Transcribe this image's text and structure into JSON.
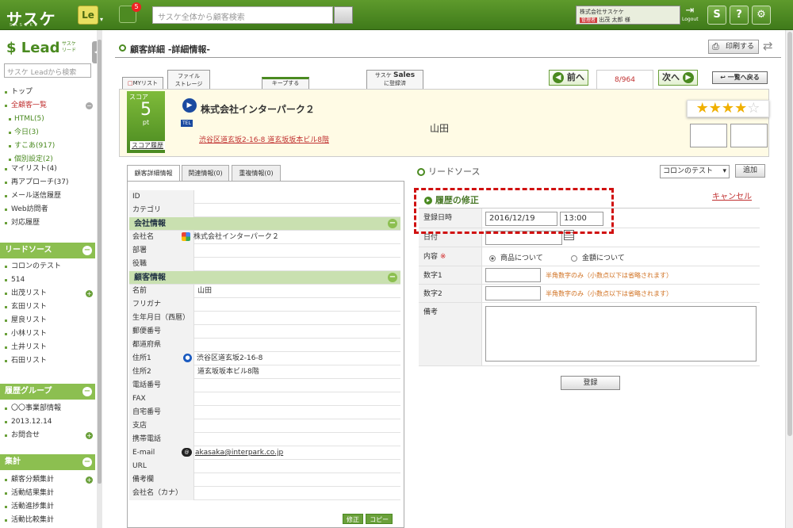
{
  "app": {
    "logo": "サスケ",
    "logo_sub": "SASUKE",
    "le": "Le",
    "notif_count": "5",
    "search_placeholder": "サスケ全体から顧客検索",
    "company": "株式会社サスケケ",
    "admin_tag": "管理者",
    "user": "出茂 太郎 様",
    "logout": "Logout"
  },
  "sidebar": {
    "logo": "Lead",
    "logo_sub1": "サスケ",
    "logo_sub2": "リード",
    "search_placeholder": "サスケ Leadから検索",
    "nav1": [
      "トップ",
      "全顧客一覧",
      "HTML(5)",
      "今日(3)",
      "すこあ(917)",
      "個別設定(2)"
    ],
    "nav2": [
      "マイリスト(4)",
      "再アプローチ(37)",
      "メール送信履歴",
      "Web訪問者",
      "対応履歴"
    ],
    "sec_lead": "リードソース",
    "leads": [
      "コロンのテスト",
      "514",
      "出茂リスト",
      "玄田リスト",
      "屋良リスト",
      "小林リスト",
      "土井リスト",
      "石田リスト"
    ],
    "sec_group": "履歴グループ",
    "groups": [
      "〇〇事業部情報",
      "2013.12.14",
      "お問合せ"
    ],
    "sec_total": "集計",
    "totals": [
      "顧客分類集計",
      "活動結果集計",
      "活動進捗集計",
      "活動比較集計"
    ]
  },
  "page": {
    "title": "顧客詳細 -詳細情報-",
    "print": "印刷する",
    "myl": "MYリスト",
    "file1": "ファイル",
    "file2": "ストレージ",
    "keep": "キープする",
    "sales1": "サスケ",
    "sales2": "Sales",
    "sales3": "に登録済",
    "prev": "前へ",
    "next": "次へ",
    "count": "8/964",
    "back": "一覧へ戻る"
  },
  "customer": {
    "score_label": "スコア",
    "score": "5",
    "score_unit": "pt",
    "score_link": "スコア履歴",
    "name": "株式会社インターパーク２",
    "tel": "TEL",
    "address": "渋谷区道玄坂2-16-8 道玄坂坂本ビル8階",
    "person": "山田",
    "stars": 4
  },
  "tabs": [
    "顧客詳細情報",
    "関連情報(0)",
    "重複情報(0)"
  ],
  "info": {
    "id": "ID",
    "category": "カテゴリ",
    "sec_company": "会社情報",
    "company_name_k": "会社名",
    "company_name_v": "株式会社インターパーク２",
    "dept": "部署",
    "role": "役職",
    "sec_customer": "顧客情報",
    "name_k": "名前",
    "name_v": "山田",
    "kana": "フリガナ",
    "birth": "生年月日（西暦）",
    "zip": "郵便番号",
    "pref": "都道府県",
    "addr1_k": "住所1",
    "addr1_v": "渋谷区道玄坂2-16-8",
    "addr2_k": "住所2",
    "addr2_v": "道玄坂坂本ビル8階",
    "phone": "電話番号",
    "fax": "FAX",
    "home": "自宅番号",
    "branch": "支店",
    "mobile": "携帯電話",
    "email_k": "E-mail",
    "email_v": "akasaka@interpark.co.jp",
    "url": "URL",
    "note": "備考欄",
    "kana2": "会社名（カナ）",
    "edit": "修正",
    "copy": "コピー"
  },
  "right": {
    "title": "リードソース",
    "select": "コロンのテスト",
    "add": "追加",
    "history": "履歴の修正",
    "cancel": "キャンセル",
    "date_k": "登録日時",
    "date_v": "2016/12/19",
    "time_v": "13:00",
    "day_k": "日付",
    "content_k": "内容",
    "req": "※",
    "opt1": "商品について",
    "opt2": "金額について",
    "num1": "数字1",
    "num2": "数字2",
    "hint": "半角数字のみ（小数点以下は省略されます）",
    "remarks": "備考",
    "submit": "登録"
  }
}
